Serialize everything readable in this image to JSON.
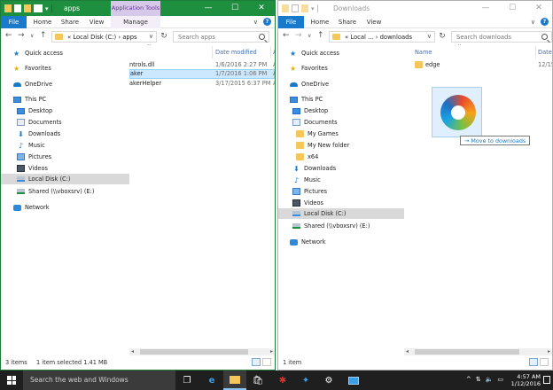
{
  "colors": {
    "accent": "#1979ca",
    "left_titlebar": "#1e8f3e",
    "ctx_tab": "#d6c8e8",
    "selection": "#cce8ff"
  },
  "left": {
    "title": "apps",
    "context_tab_title": "Application Tools",
    "ribbon_tabs": [
      "File",
      "Home",
      "Share",
      "View",
      "Manage"
    ],
    "address": "« Local Disk (C:) › apps",
    "search_placeholder": "Search apps",
    "columns": {
      "date": "Date modified",
      "type": "A"
    },
    "nav": [
      "Quick access",
      "Favorites",
      "OneDrive",
      "This PC",
      "Desktop",
      "Documents",
      "Downloads",
      "Music",
      "Pictures",
      "Videos",
      "Local Disk (C:)",
      "Shared (\\\\vboxsrv) (E:)",
      "Network"
    ],
    "files": [
      {
        "name": "ntrols.dll",
        "date": "1/6/2016 2:27 PM",
        "type": "A"
      },
      {
        "name": "aker",
        "date": "1/7/2016 1:06 PM",
        "type": "A"
      },
      {
        "name": "akerHelper",
        "date": "3/17/2015 6:37 PM",
        "type": "A"
      }
    ],
    "status_items": "3 items",
    "status_selected": "1 item selected  1.41 MB"
  },
  "right": {
    "title": "Downloads",
    "ribbon_tabs": [
      "File",
      "Home",
      "Share",
      "View"
    ],
    "address": "« Local ... › downloads",
    "search_placeholder": "Search downloads",
    "columns": {
      "name": "Name",
      "date": "Date"
    },
    "nav": [
      "Quick access",
      "Favorites",
      "OneDrive",
      "This PC",
      "Desktop",
      "Documents",
      "My Games",
      "My New folder",
      "x64",
      "Downloads",
      "Music",
      "Pictures",
      "Videos",
      "Local Disk (C:)",
      "Shared (\\\\vboxsrv) (E:)",
      "Network"
    ],
    "files": [
      {
        "name": "edge",
        "date": "12/15"
      }
    ],
    "status_items": "1 item"
  },
  "drag_tip": "Move to downloads",
  "taskbar": {
    "search_text": "Search the web and Windows",
    "time": "4:57 AM",
    "date": "1/12/2016"
  }
}
